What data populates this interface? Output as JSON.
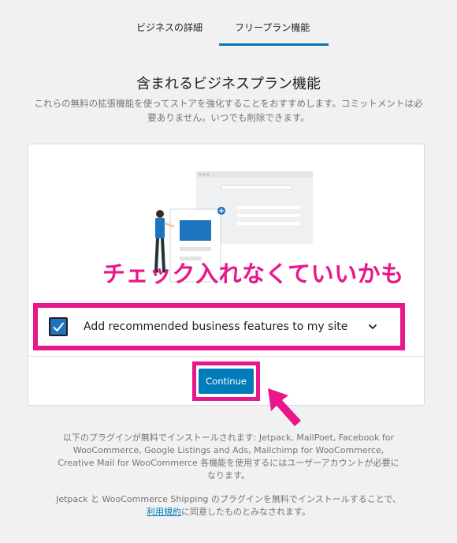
{
  "tabs": {
    "details": "ビジネスの詳細",
    "free_plan": "フリープラン機能"
  },
  "heading": "含まれるビジネスプラン機能",
  "subtext": "これらの無料の拡張機能を使ってストアを強化することをおすすめします。コミットメントは必要ありません。いつでも削除できます。",
  "annotation": "チェック入れなくていいかも",
  "option": {
    "label": "Add recommended business features to my site",
    "checked": true
  },
  "continue_label": "Continue",
  "footnote": {
    "plugins_text": "以下のプラグインが無料でインストールされます: Jetpack, MailPoet, Facebook for WooCommerce, Google Listings and Ads, Mailchimp for WooCommerce, Creative Mail for WooCommerce 各機能を使用するにはユーザーアカウントが必要になります。",
    "terms_before": "Jetpack と WooCommerce Shipping のプラグインを無料でインストールすることで、",
    "terms_link": "利用規約",
    "terms_after": "に同意したものとみなされます。"
  },
  "colors": {
    "accent": "#007cba",
    "annotation": "#e8178a"
  }
}
